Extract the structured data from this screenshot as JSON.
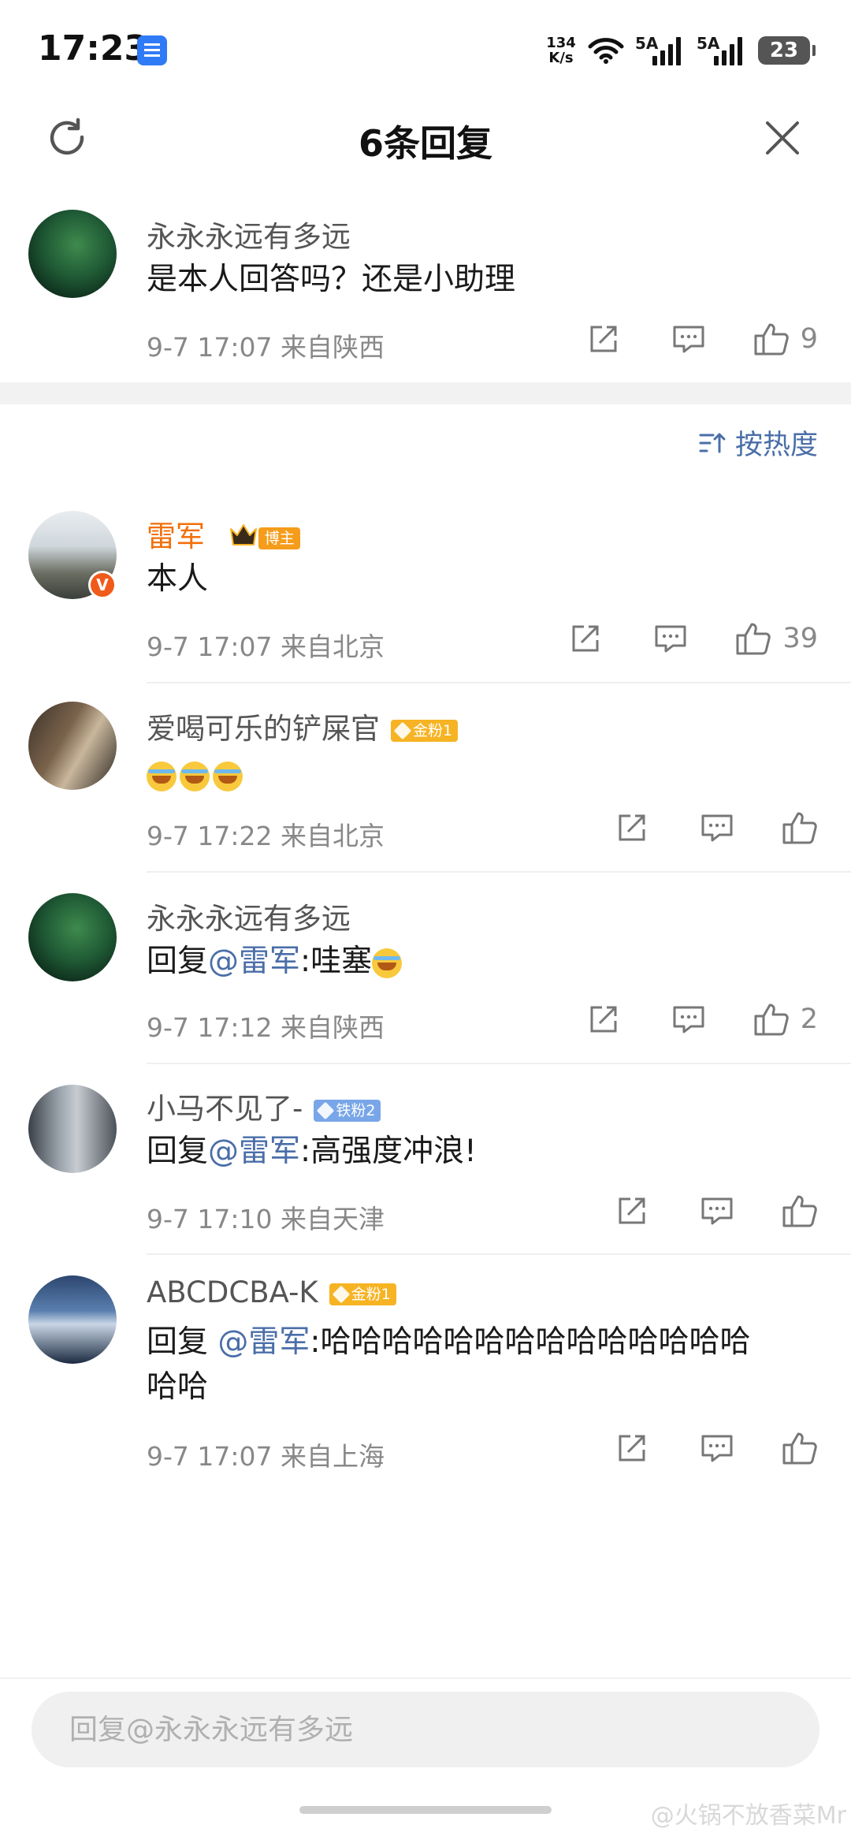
{
  "status_bar": {
    "time": "17:23",
    "net_speed_value": "134",
    "net_speed_unit": "K/s",
    "signal1_label": "5A",
    "signal2_label": "5A",
    "battery": "23"
  },
  "header": {
    "title": "6条回复"
  },
  "root_comment": {
    "username": "永永永远有多远",
    "text": "是本人回答吗？还是小助理",
    "meta": "9-7 17:07 来自陕西",
    "likes": "9"
  },
  "sort": {
    "label": "按热度"
  },
  "replies": [
    {
      "username": "雷军",
      "badge": "博主",
      "text": "本人",
      "meta": "9-7 17:07 来自北京",
      "likes": "39"
    },
    {
      "username": "爱喝可乐的铲屎官",
      "badge": "金粉1",
      "text": "",
      "meta": "9-7 17:22 来自北京",
      "likes": ""
    },
    {
      "username": "永永永远有多远",
      "text_prefix": "回复",
      "mention": "@雷军",
      "text_suffix": ":哇塞",
      "meta": "9-7 17:12 来自陕西",
      "likes": "2"
    },
    {
      "username": "小马不见了-",
      "badge": "铁粉2",
      "text_prefix": "回复",
      "mention": "@雷军",
      "text_suffix": ":高强度冲浪!",
      "meta": "9-7 17:10 来自天津",
      "likes": ""
    },
    {
      "username": "ABCDCBA-K",
      "badge": "金粉1",
      "text_prefix": "回复 ",
      "mention": "@雷军",
      "text_suffix": ":哈哈哈哈哈哈哈哈哈哈哈哈哈哈",
      "text_line2": "哈哈",
      "meta": "9-7 17:07 来自上海",
      "likes": ""
    }
  ],
  "reply_input": {
    "placeholder": "回复@永永永远有多远"
  },
  "watermark": "@火锅不放香菜Mr",
  "colors": {
    "accent_blue": "#4a6ea8",
    "host_orange": "#f26f0a",
    "gold_badge": "#f6b323",
    "iron_badge": "#79a6e8"
  }
}
